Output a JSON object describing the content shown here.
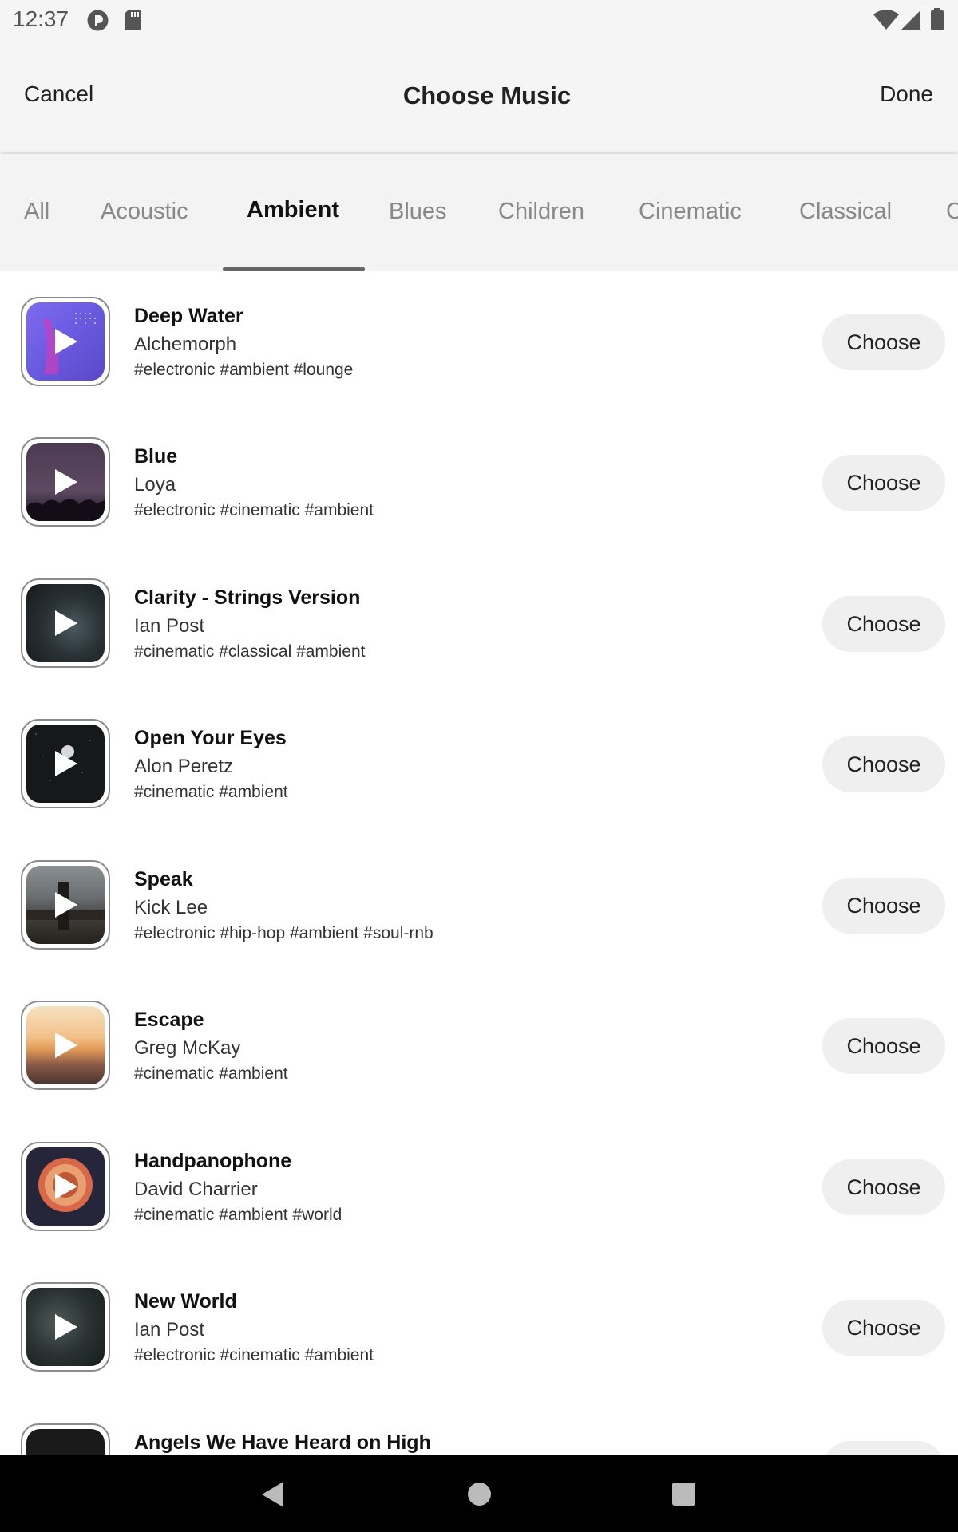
{
  "status_bar": {
    "time": "12:37",
    "left_icons": [
      "pocket-casts-icon",
      "sd-card-icon"
    ],
    "right_icons": [
      "wifi-icon",
      "signal-icon",
      "battery-icon"
    ]
  },
  "header": {
    "cancel_label": "Cancel",
    "title": "Choose Music",
    "done_label": "Done"
  },
  "tabs": {
    "items": [
      "All",
      "Acoustic",
      "Ambient",
      "Blues",
      "Children",
      "Cinematic",
      "Classical",
      "C"
    ],
    "selected": "Ambient"
  },
  "tracks": [
    {
      "title": "Deep Water",
      "artist": "Alchemorph",
      "tags": "#electronic #ambient #lounge",
      "choose_label": "Choose"
    },
    {
      "title": "Blue",
      "artist": "Loya",
      "tags": "#electronic #cinematic #ambient",
      "choose_label": "Choose"
    },
    {
      "title": "Clarity - Strings Version",
      "artist": "Ian Post",
      "tags": "#cinematic #classical #ambient",
      "choose_label": "Choose"
    },
    {
      "title": "Open Your Eyes",
      "artist": "Alon Peretz",
      "tags": "#cinematic #ambient",
      "choose_label": "Choose"
    },
    {
      "title": "Speak",
      "artist": "Kick Lee",
      "tags": "#electronic #hip-hop #ambient #soul-rnb",
      "choose_label": "Choose"
    },
    {
      "title": "Escape",
      "artist": "Greg McKay",
      "tags": "#cinematic #ambient",
      "choose_label": "Choose"
    },
    {
      "title": "Handpanophone",
      "artist": "David Charrier",
      "tags": "#cinematic #ambient #world",
      "choose_label": "Choose"
    },
    {
      "title": "New World",
      "artist": "Ian Post",
      "tags": "#electronic #cinematic #ambient",
      "choose_label": "Choose"
    },
    {
      "title": "Angels We Have Heard on High",
      "artist": "",
      "tags": "",
      "choose_label": ""
    }
  ],
  "colors": {
    "header_bg": "#f5f5f5",
    "tab_indicator": "#666666",
    "button_bg": "#efefef",
    "nav_bar_bg": "#000000"
  },
  "nav_bar": {
    "icons": [
      "back-icon",
      "home-icon",
      "recents-icon"
    ]
  }
}
